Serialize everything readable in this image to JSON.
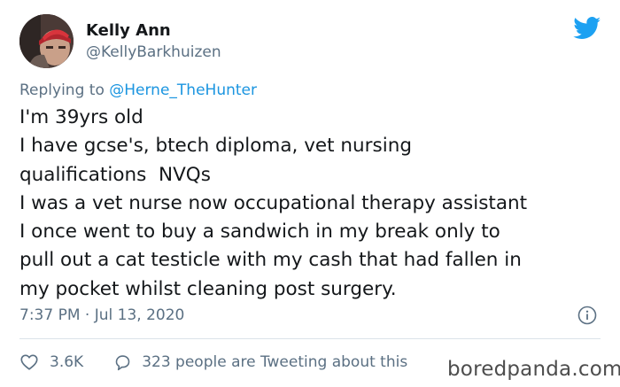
{
  "author": {
    "display_name": "Kelly Ann",
    "handle": "@KellyBarkhuizen",
    "avatar_icon": "user-avatar"
  },
  "reply": {
    "prefix": "Replying to",
    "mention": "@Herne_TheHunter"
  },
  "tweet_lines": [
    "I'm 39yrs old",
    "I have gcse's, btech diploma, vet nursing",
    "qualifications  NVQs",
    "I was a vet nurse now occupational therapy assistant",
    "I once went to buy a sandwich in my break only to",
    "pull out a cat testicle with my cash that had fallen in",
    "my pocket whilst cleaning post surgery."
  ],
  "meta": {
    "timestamp": "7:37 PM · Jul 13, 2020"
  },
  "engagement": {
    "likes": "3.6K",
    "conversation": "323 people are Tweeting about this"
  },
  "watermark": "boredpanda.com",
  "colors": {
    "twitter_blue": "#1da1f2",
    "mention_blue": "#1b95e0",
    "secondary_text": "#5b7083",
    "primary_text": "#14171a"
  }
}
